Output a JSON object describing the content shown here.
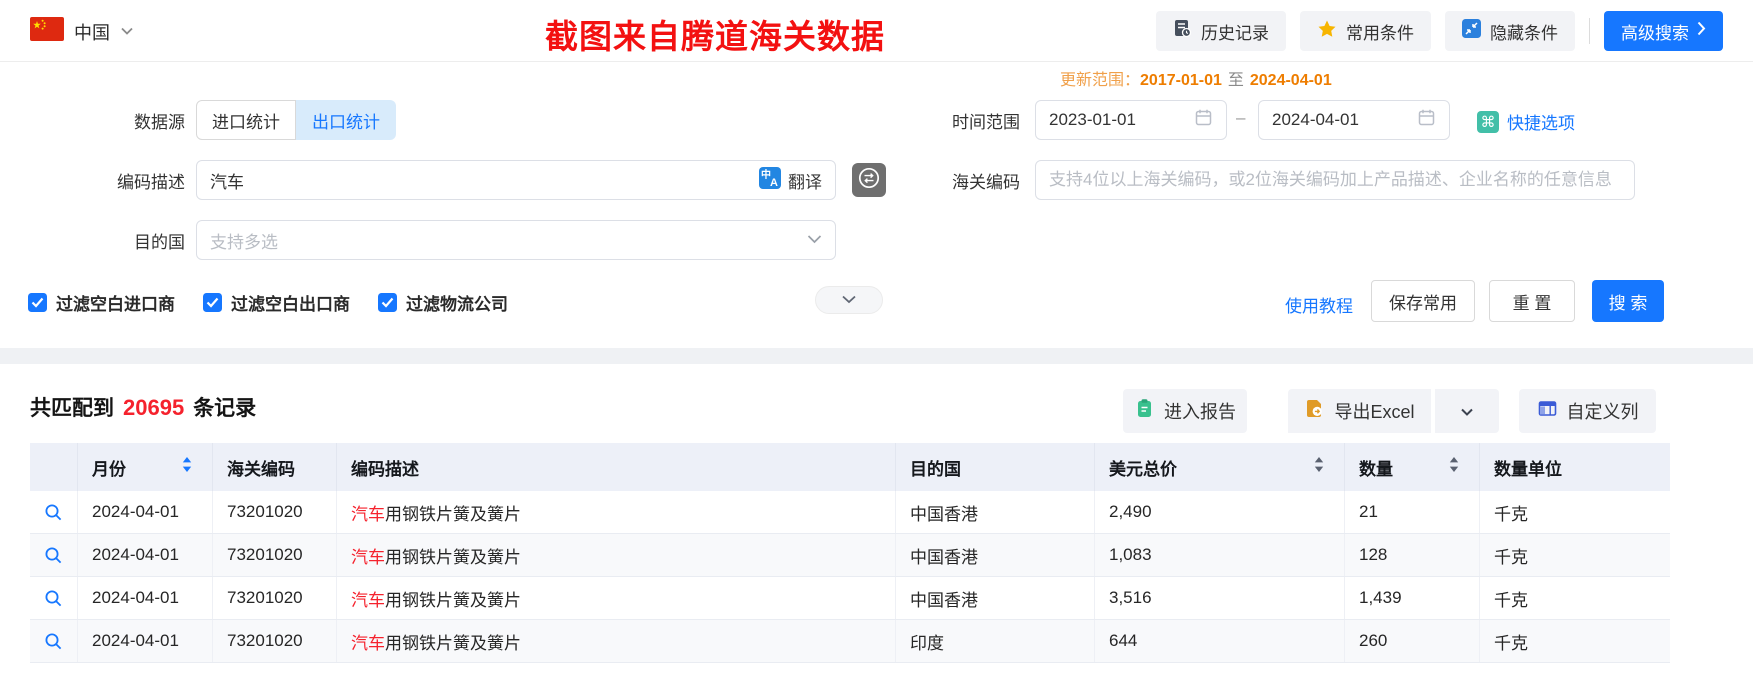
{
  "topbar": {
    "country": "中国",
    "banner": "截图来自腾道海关数据",
    "buttons": {
      "history": "历史记录",
      "favorites": "常用条件",
      "hide": "隐藏条件",
      "advanced": "高级搜索"
    }
  },
  "form": {
    "update_range": {
      "label": "更新范围：",
      "from": "2017-01-01",
      "to_word": "至",
      "to": "2024-04-01"
    },
    "data_source": {
      "label": "数据源",
      "tabs": [
        {
          "label": "进口统计"
        },
        {
          "label": "出口统计"
        }
      ],
      "active_tab": "出口统计"
    },
    "time_range": {
      "label": "时间范围",
      "start": "2023-01-01",
      "separator": "–",
      "end": "2024-04-01",
      "quick_label": "快捷选项",
      "quick_icon": "⌘"
    },
    "code_desc": {
      "label": "编码描述",
      "value": "汽车",
      "translate_label": "翻译"
    },
    "hs_code": {
      "label": "海关编码",
      "placeholder": "支持4位以上海关编码，或2位海关编码加上产品描述、企业名称的任意信息"
    },
    "dest_country": {
      "label": "目的国",
      "placeholder": "支持多选"
    },
    "filters": [
      {
        "label": "过滤空白进口商",
        "checked": true
      },
      {
        "label": "过滤空白出口商",
        "checked": true
      },
      {
        "label": "过滤物流公司",
        "checked": true
      }
    ],
    "actions": {
      "tutorial": "使用教程",
      "save": "保存常用",
      "reset": "重 置",
      "search": "搜 索"
    }
  },
  "results": {
    "summary": {
      "prefix": "共匹配到",
      "count": "20695",
      "suffix": "条记录"
    },
    "toolbar": {
      "report": "进入报告",
      "export": "导出Excel",
      "custom_columns": "自定义列"
    },
    "table": {
      "columns": [
        {
          "label": ""
        },
        {
          "label": "月份",
          "sortable": true
        },
        {
          "label": "海关编码"
        },
        {
          "label": "编码描述"
        },
        {
          "label": "目的国"
        },
        {
          "label": "美元总价",
          "sortable": true
        },
        {
          "label": "数量",
          "sortable": true
        },
        {
          "label": "数量单位"
        }
      ],
      "rows": [
        {
          "month": "2024-04-01",
          "code": "73201020",
          "desc_highlight": "汽车",
          "desc_rest": "用钢铁片簧及簧片",
          "country": "中国香港",
          "usd": "2,490",
          "qty": "21",
          "unit": "千克"
        },
        {
          "month": "2024-04-01",
          "code": "73201020",
          "desc_highlight": "汽车",
          "desc_rest": "用钢铁片簧及簧片",
          "country": "中国香港",
          "usd": "1,083",
          "qty": "128",
          "unit": "千克"
        },
        {
          "month": "2024-04-01",
          "code": "73201020",
          "desc_highlight": "汽车",
          "desc_rest": "用钢铁片簧及簧片",
          "country": "中国香港",
          "usd": "3,516",
          "qty": "1,439",
          "unit": "千克"
        },
        {
          "month": "2024-04-01",
          "code": "73201020",
          "desc_highlight": "汽车",
          "desc_rest": "用钢铁片簧及簧片",
          "country": "印度",
          "usd": "644",
          "qty": "260",
          "unit": "千克"
        }
      ]
    }
  },
  "colors": {
    "primary_blue": "#1677ff",
    "banner_red": "#f31111",
    "count_red": "#f5222d",
    "date_orange": "#ee7d00",
    "teal_icon": "#42bfa8",
    "star_yellow": "#f7b500"
  }
}
